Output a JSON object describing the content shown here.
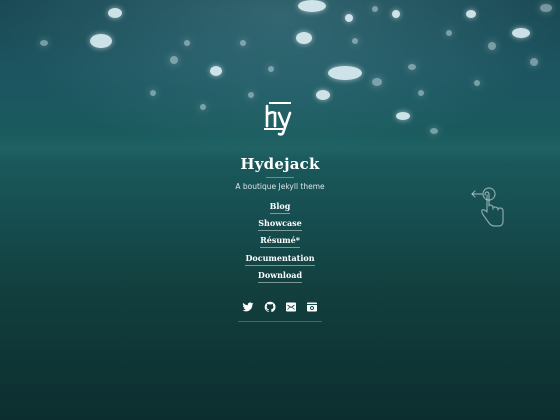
{
  "site": {
    "title": "Hydejack",
    "tagline": "A boutique Jekyll theme"
  },
  "nav": {
    "items": [
      {
        "label": "Blog"
      },
      {
        "label": "Showcase"
      },
      {
        "label": "Résumé*"
      },
      {
        "label": "Documentation"
      },
      {
        "label": "Download"
      }
    ]
  },
  "socials": [
    {
      "icon": "twitter-icon"
    },
    {
      "icon": "github-icon"
    },
    {
      "icon": "email-icon"
    },
    {
      "icon": "download-icon"
    }
  ],
  "colors": {
    "background_top": "#1c5560",
    "background_bottom": "#0c2e2f",
    "text": "#ffffff"
  }
}
